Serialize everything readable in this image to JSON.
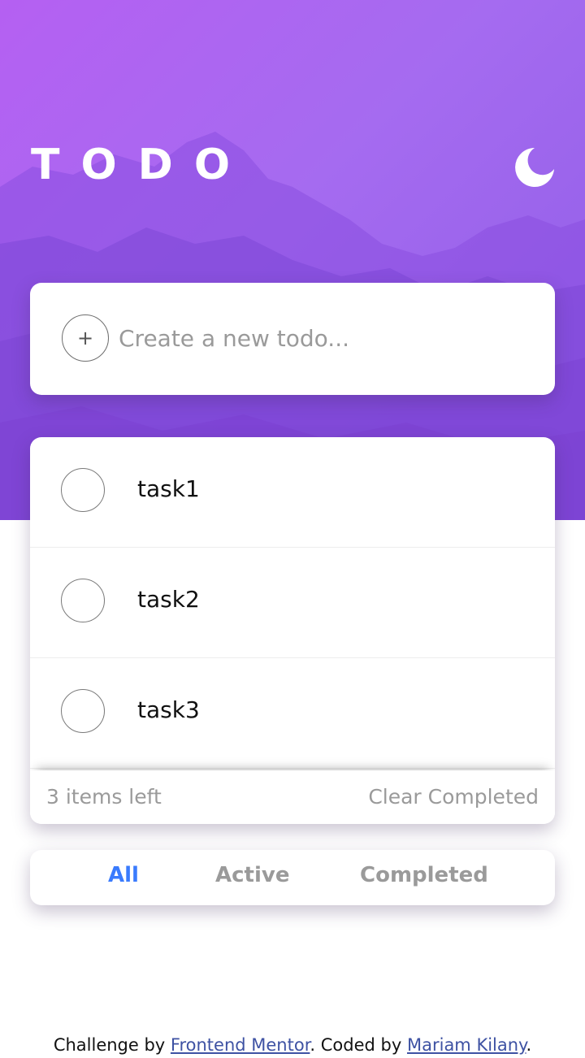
{
  "header": {
    "logo": "TODO",
    "theme_toggle_icon": "moon-icon"
  },
  "create": {
    "plus_icon": "+",
    "placeholder": "Create a new todo..."
  },
  "tasks": [
    {
      "label": "task1",
      "completed": false
    },
    {
      "label": "task2",
      "completed": false
    },
    {
      "label": "task3",
      "completed": false
    }
  ],
  "footer": {
    "items_left": "3 items left",
    "clear_completed": "Clear Completed"
  },
  "filters": {
    "all": "All",
    "active": "Active",
    "completed": "Completed",
    "selected": "All"
  },
  "attribution": {
    "prefix": "Challenge by ",
    "mentor_link": "Frontend Mentor",
    "middle": ". Coded by ",
    "author_link": "Mariam Kilany",
    "suffix": "."
  },
  "colors": {
    "accent": "#3a7bfd",
    "hero_gradient_start": "#b560f2",
    "hero_gradient_end": "#8e5ce6",
    "muted_text": "#9a9a9a"
  }
}
